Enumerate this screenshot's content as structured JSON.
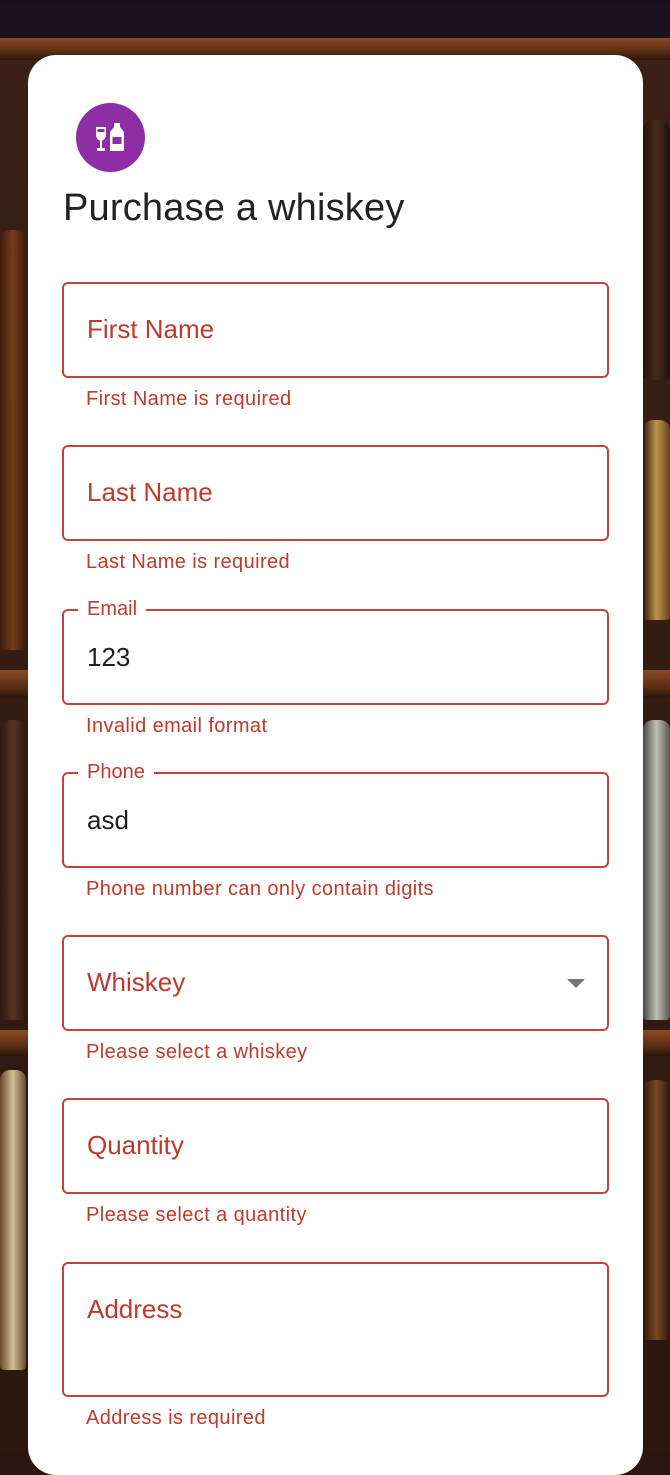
{
  "form": {
    "title": "Purchase a whiskey",
    "logo_icon": "wine-glass-bottle-icon",
    "accent_color": "#8e2ea6",
    "error_color": "#c0392b"
  },
  "fields": {
    "first_name": {
      "label": "First Name",
      "value": "",
      "error": "First Name is required"
    },
    "last_name": {
      "label": "Last Name",
      "value": "",
      "error": "Last Name is required"
    },
    "email": {
      "label": "Email",
      "value": "123",
      "error": "Invalid email format"
    },
    "phone": {
      "label": "Phone",
      "value": "asd",
      "error": "Phone number can only contain digits"
    },
    "whiskey": {
      "label": "Whiskey",
      "value": "",
      "error": "Please select a whiskey",
      "icon": "chevron-down-icon"
    },
    "quantity": {
      "label": "Quantity",
      "value": "",
      "error": "Please select a quantity"
    },
    "address": {
      "label": "Address",
      "value": "",
      "error": "Address is required"
    }
  }
}
